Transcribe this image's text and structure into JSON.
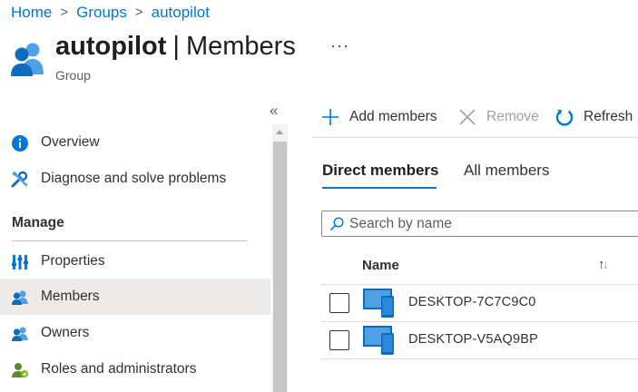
{
  "breadcrumb": {
    "items": [
      "Home",
      "Groups",
      "autopilot"
    ],
    "separator": ">"
  },
  "header": {
    "group_name": "autopilot",
    "separator": "|",
    "page_name": "Members",
    "subtitle": "Group",
    "more_label": "···"
  },
  "nav": {
    "collapse_glyph": "«",
    "items": [
      {
        "label": "Overview",
        "icon": "info-icon"
      },
      {
        "label": "Diagnose and solve problems",
        "icon": "wrench-icon"
      }
    ],
    "manage_section": {
      "label": "Manage",
      "items": [
        {
          "label": "Properties",
          "icon": "properties-icon"
        },
        {
          "label": "Members",
          "icon": "members-icon",
          "selected": true
        },
        {
          "label": "Owners",
          "icon": "owners-icon"
        },
        {
          "label": "Roles and administrators",
          "icon": "roles-icon"
        }
      ]
    }
  },
  "toolbar": {
    "add_members_label": "Add members",
    "remove_label": "Remove",
    "refresh_label": "Refresh"
  },
  "tabs": [
    {
      "label": "Direct members",
      "active": true
    },
    {
      "label": "All members",
      "active": false
    }
  ],
  "search": {
    "placeholder": "Search by name",
    "value": ""
  },
  "table": {
    "column_header": "Name",
    "sort_glyph_up": "↑",
    "sort_glyph_down": "↓",
    "rows": [
      {
        "name": "DESKTOP-7C7C9C0",
        "checked": false
      },
      {
        "name": "DESKTOP-V5AQ9BP",
        "checked": false
      }
    ]
  },
  "colors": {
    "accent": "#0078d4",
    "selected_nav_bg": "#edebe9",
    "text_primary": "#323130",
    "text_disabled": "#a19f9d"
  }
}
